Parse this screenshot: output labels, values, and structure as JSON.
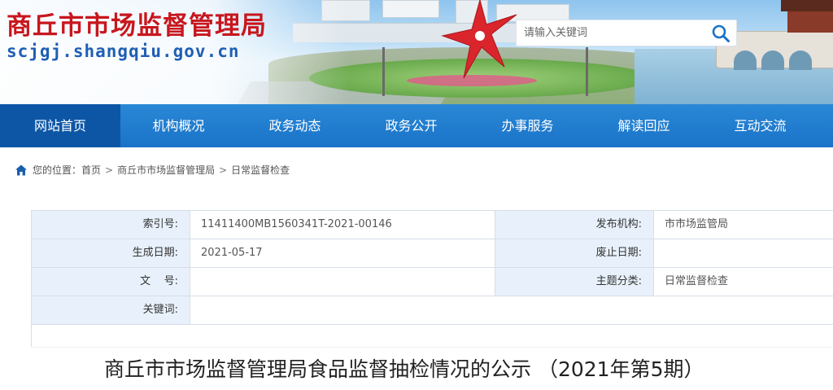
{
  "header": {
    "site_title": "商丘市市场监督管理局",
    "site_domain": "scjgj.shangqiu.gov.cn",
    "search": {
      "placeholder": "请输入关键词"
    }
  },
  "nav": {
    "items": [
      {
        "label": "网站首页",
        "active": true
      },
      {
        "label": "机构概况",
        "active": false
      },
      {
        "label": "政务动态",
        "active": false
      },
      {
        "label": "政务公开",
        "active": false
      },
      {
        "label": "办事服务",
        "active": false
      },
      {
        "label": "解读回应",
        "active": false
      },
      {
        "label": "互动交流",
        "active": false
      }
    ]
  },
  "breadcrumb": {
    "prefix": "您的位置：",
    "items": [
      "首页",
      "商丘市市场监督管理局",
      "日常监督检查"
    ]
  },
  "meta": {
    "rows": [
      {
        "l1": "索引号:",
        "v1": "11411400MB1560341T-2021-00146",
        "l2": "发布机构:",
        "v2": "市市场监管局"
      },
      {
        "l1": "生成日期:",
        "v1": "2021-05-17",
        "l2": "废止日期:",
        "v2": ""
      },
      {
        "l1": "文    号:",
        "v1": "",
        "l2": "主题分类:",
        "v2": "日常监督检查"
      },
      {
        "l1": "关键词:",
        "v1": ""
      }
    ]
  },
  "article": {
    "title": "商丘市市场监督管理局食品监督抽检情况的公示 （2021年第5期）"
  },
  "colors": {
    "title_red": "#c8161d",
    "domain_blue": "#1e5fb4",
    "nav_blue": "#1a73c8",
    "nav_active": "#0d56a6",
    "label_bg": "#e8f1fb"
  }
}
